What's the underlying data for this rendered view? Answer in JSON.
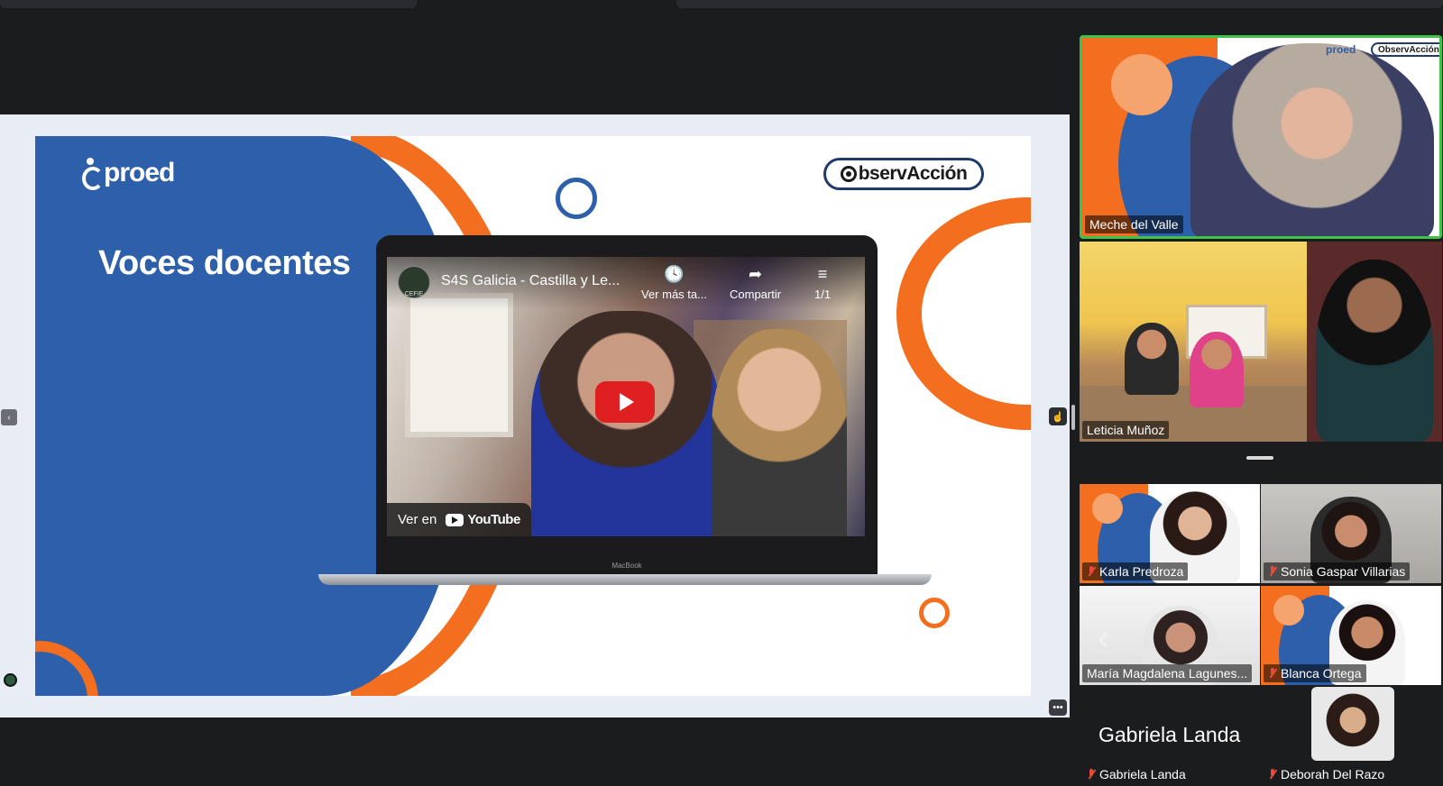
{
  "slide": {
    "logo_text": "proed",
    "title": "Voces docentes",
    "partner_logo_text": "bservAcción",
    "video": {
      "title": "S4S Galicia - Castilla y Le...",
      "channel_badge": "CEFIE",
      "watch_later_label": "Ver más ta...",
      "share_label": "Compartir",
      "playlist_label": "1/1",
      "watch_on_label": "Ver en",
      "youtube_label": "YouTube",
      "laptop_label": "MacBook"
    }
  },
  "participants": {
    "speaker": {
      "name": "Meche del Valle",
      "brand": "proed",
      "partner": "ObservAcción"
    },
    "second": {
      "name": "Leticia Muñoz"
    },
    "grid": [
      {
        "name": "Karla Predroza",
        "muted": true
      },
      {
        "name": "Sonia Gaspar Villarias",
        "muted": true
      },
      {
        "name": "María Magdalena Lagunes...",
        "muted": false
      },
      {
        "name": "Blanca Ortega",
        "muted": true
      },
      {
        "name": "Gabriela Landa",
        "display_name": "Gabriela Landa",
        "muted": true
      },
      {
        "name": "Deborah Del Razo",
        "muted": true
      }
    ]
  },
  "icons": {
    "nav_left": "chevron-left-icon",
    "cursor": "pointer-hand-icon",
    "more": "more-dots-icon"
  },
  "colors": {
    "brand_blue": "#2e5fab",
    "brand_orange": "#f36e1e",
    "active_speaker_border": "#3fc24a",
    "muted_mic": "#e84b3c"
  }
}
